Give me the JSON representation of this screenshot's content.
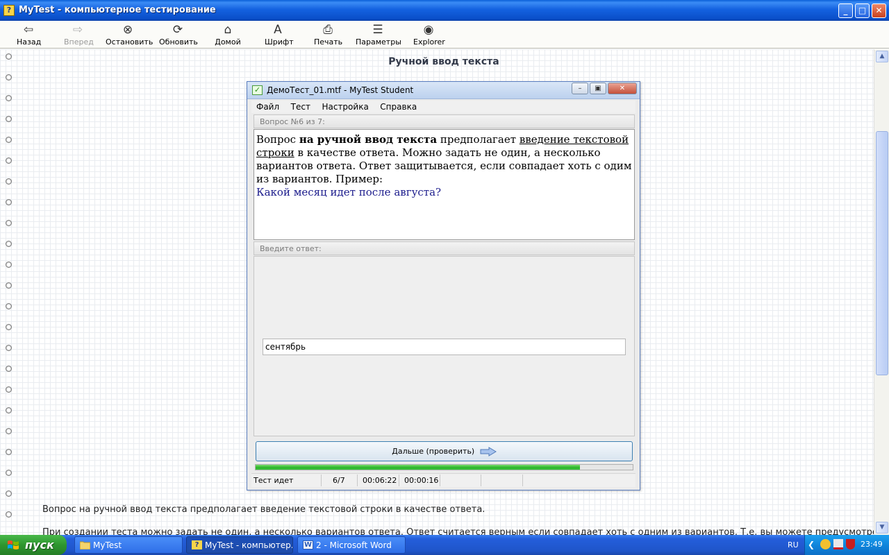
{
  "window": {
    "title": "MyTest - компьютерное тестирование",
    "controls": {
      "minimize": "_",
      "maximize": "□",
      "close": "✕"
    }
  },
  "toolbar": {
    "buttons": [
      {
        "label": "Назад",
        "icon": "back-arrow-icon",
        "glyph": "⇦",
        "enabled": true
      },
      {
        "label": "Вперед",
        "icon": "forward-arrow-icon",
        "glyph": "⇨",
        "enabled": false
      },
      {
        "label": "Остановить",
        "icon": "stop-icon",
        "glyph": "⊗",
        "enabled": true
      },
      {
        "label": "Обновить",
        "icon": "refresh-icon",
        "glyph": "⟳",
        "enabled": true
      },
      {
        "label": "Домой",
        "icon": "home-icon",
        "glyph": "⌂",
        "enabled": true
      },
      {
        "label": "Шрифт",
        "icon": "font-icon",
        "glyph": "A",
        "enabled": true
      },
      {
        "label": "Печать",
        "icon": "print-icon",
        "glyph": "⎙",
        "enabled": true
      },
      {
        "label": "Параметры",
        "icon": "settings-icon",
        "glyph": "☰",
        "enabled": true
      },
      {
        "label": "Explorer",
        "icon": "explorer-icon",
        "glyph": "◉",
        "enabled": true
      }
    ]
  },
  "page": {
    "heading": "Ручной ввод текста",
    "paragraph1": "Вопрос на ручной ввод текста предполагает введение текстовой строки в качестве ответа.",
    "paragraph2": "При создании теста можно задать не один, а несколько вариантов ответа. Ответ считается верным если совпадает хоть с одним из вариантов. Т.е. вы можете предусмотреть"
  },
  "dialog": {
    "title": "ДемоТест_01.mtf - MyTest Student",
    "menu": [
      "Файл",
      "Тест",
      "Настройка",
      "Справка"
    ],
    "question_header": "Вопрос №6 из 7:",
    "question": {
      "part1": "Вопрос ",
      "bold": "на ручной ввод текста",
      "part2": " предполагает ",
      "underline": "введение текстовой строки",
      "part3": " в качестве ответа. Можно задать не один, а несколько вариантов ответа. Ответ защитывается, если совпадает хоть с одим из вариантов. Пример:",
      "example": "Какой месяц идет после августа?"
    },
    "answer_header": "Введите ответ:",
    "answer_value": "сентябрь",
    "next_button": "Дальше (проверить)",
    "progress": 0.86,
    "status": {
      "state": "Тест идет",
      "counter": "6/7",
      "elapsed": "00:06:22",
      "question_time": "00:00:16"
    }
  },
  "taskbar": {
    "start_label": "пуск",
    "tasks": [
      {
        "label": "MyTest",
        "icon": "folder-icon"
      },
      {
        "label": "MyTest - компьютер...",
        "icon": "mytest-app-icon"
      },
      {
        "label": "2 - Microsoft Word",
        "icon": "word-icon"
      }
    ],
    "language": "RU",
    "clock": "23:49"
  }
}
